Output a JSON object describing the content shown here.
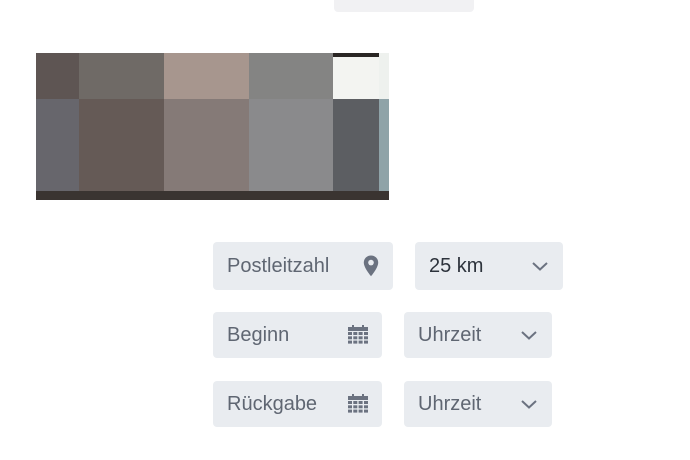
{
  "form": {
    "postal": {
      "placeholder": "Postleitzahl",
      "icon": "map-pin-icon"
    },
    "radius": {
      "value": "25 km",
      "icon": "chevron-down-icon"
    },
    "start": {
      "placeholder": "Beginn",
      "icon": "calendar-icon"
    },
    "start_time": {
      "placeholder": "Uhrzeit",
      "icon": "chevron-down-icon"
    },
    "return": {
      "placeholder": "Rückgabe",
      "icon": "calendar-icon"
    },
    "return_time": {
      "placeholder": "Uhrzeit",
      "icon": "chevron-down-icon"
    }
  },
  "colors": {
    "field_bg": "#e9ecf0",
    "text_placeholder": "#5f6672",
    "text_value": "#2d333c",
    "icon": "#6b7280"
  }
}
